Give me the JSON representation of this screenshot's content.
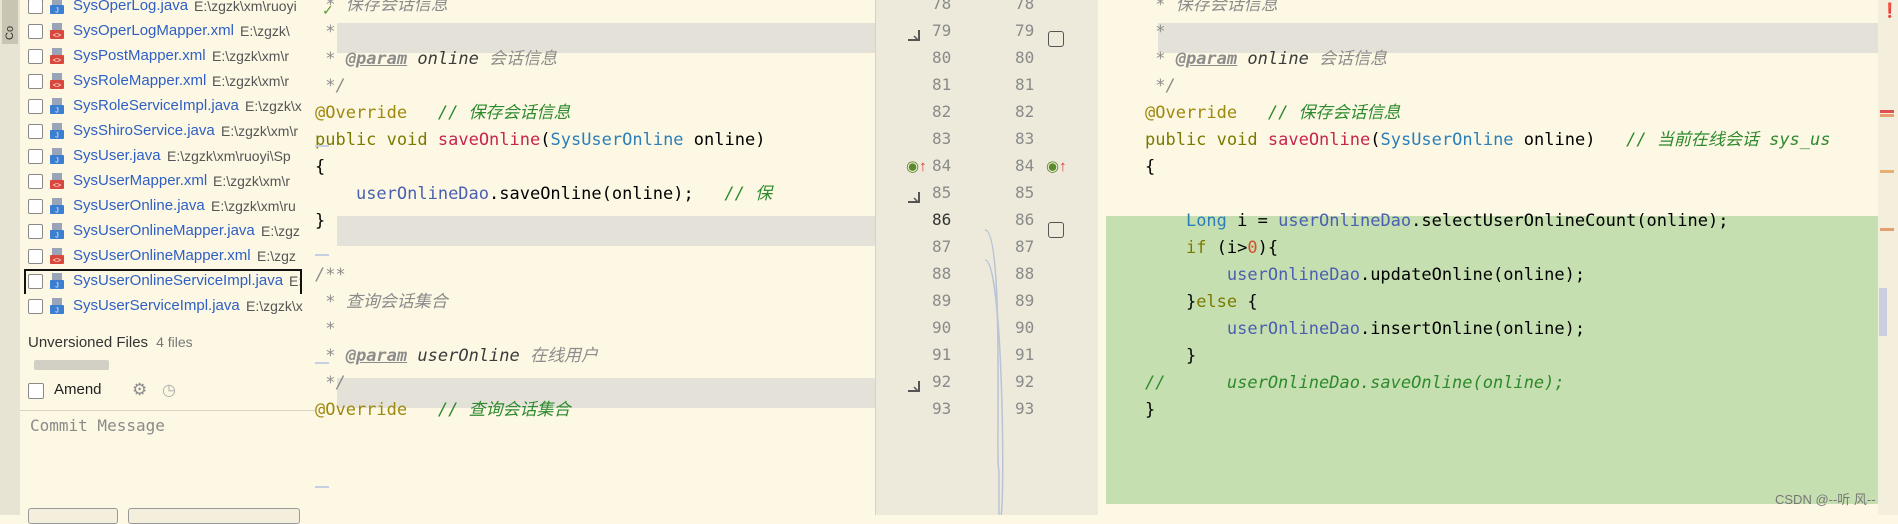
{
  "toolstrip": {
    "label": "Co"
  },
  "commit_panel": {
    "files": [
      {
        "name": "SysOperLog.java",
        "path": "E:\\zgzk\\xm\\ruoyi",
        "icon": "java-class-icon"
      },
      {
        "name": "SysOperLogMapper.xml",
        "path": "E:\\zgzk\\",
        "icon": "xml-icon"
      },
      {
        "name": "SysPostMapper.xml",
        "path": "E:\\zgzk\\xm\\r",
        "icon": "xml-icon"
      },
      {
        "name": "SysRoleMapper.xml",
        "path": "E:\\zgzk\\xm\\r",
        "icon": "xml-icon"
      },
      {
        "name": "SysRoleServiceImpl.java",
        "path": "E:\\zgzk\\x",
        "icon": "java-class-icon"
      },
      {
        "name": "SysShiroService.java",
        "path": "E:\\zgzk\\xm\\r",
        "icon": "java-class-icon"
      },
      {
        "name": "SysUser.java",
        "path": "E:\\zgzk\\xm\\ruoyi\\Sp",
        "icon": "java-class-icon"
      },
      {
        "name": "SysUserMapper.xml",
        "path": "E:\\zgzk\\xm\\r",
        "icon": "xml-icon"
      },
      {
        "name": "SysUserOnline.java",
        "path": "E:\\zgzk\\xm\\ru",
        "icon": "java-class-icon"
      },
      {
        "name": "SysUserOnlineMapper.java",
        "path": "E:\\zgz",
        "icon": "java-class-icon"
      },
      {
        "name": "SysUserOnlineMapper.xml",
        "path": "E:\\zgz",
        "icon": "xml-icon"
      },
      {
        "name": "SysUserOnlineServiceImpl.java",
        "path": "E:",
        "icon": "java-class-icon",
        "selected": true
      },
      {
        "name": "SysUserServiceImpl.java",
        "path": "E:\\zgzk\\x",
        "icon": "java-class-icon"
      }
    ],
    "unversioned_label": "Unversioned Files",
    "unversioned_count": "4 files",
    "amend_label": "Amend",
    "commit_placeholder": "Commit Message"
  },
  "diff": {
    "left_lines": [
      {
        "num": "78",
        "text": " * 保存会话信息"
      },
      {
        "num": "79",
        "text": " *"
      },
      {
        "num": "80",
        "text": " * @param online 会话信息"
      },
      {
        "num": "81",
        "text": " */"
      },
      {
        "num": "82",
        "text": "@Override   // 保存会话信息"
      },
      {
        "num": "83",
        "text": "public void saveOnline(SysUserOnline online)"
      },
      {
        "num": "84",
        "text": "{"
      },
      {
        "num": "85",
        "text": "    userOnlineDao.saveOnline(online);   // 保"
      },
      {
        "num": "86",
        "text": "}"
      },
      {
        "num": "87",
        "text": ""
      },
      {
        "num": "88",
        "text": "/**"
      },
      {
        "num": "89",
        "text": " * 查询会话集合"
      },
      {
        "num": "90",
        "text": " *"
      },
      {
        "num": "91",
        "text": " * @param userOnline 在线用户"
      },
      {
        "num": "92",
        "text": " */"
      },
      {
        "num": "93",
        "text": "@Override   // 查询会话集合"
      }
    ],
    "right_lines": [
      {
        "num": "78",
        "text": " * 保存会话信息"
      },
      {
        "num": "79",
        "text": " *"
      },
      {
        "num": "80",
        "text": " * @param online 会话信息"
      },
      {
        "num": "81",
        "text": " */"
      },
      {
        "num": "82",
        "text": "@Override   // 保存会话信息"
      },
      {
        "num": "83",
        "text": "public void saveOnline(SysUserOnline online)   // 当前在线会话 sys_us"
      },
      {
        "num": "84",
        "text": "{"
      },
      {
        "num": "85",
        "text": ""
      },
      {
        "num": "86",
        "text": "    Long i = userOnlineDao.selectUserOnlineCount(online);"
      },
      {
        "num": "87",
        "text": "    if (i>0){"
      },
      {
        "num": "88",
        "text": "        userOnlineDao.updateOnline(online);"
      },
      {
        "num": "89",
        "text": "    }else {"
      },
      {
        "num": "90",
        "text": "        userOnlineDao.insertOnline(online);"
      },
      {
        "num": "91",
        "text": "    }"
      },
      {
        "num": "92",
        "text": "//      userOnlineDao.saveOnline(online);"
      },
      {
        "num": "93",
        "text": "}"
      }
    ]
  },
  "watermark": "CSDN @--听 风--",
  "colors": {
    "added_bg": "#c6dfb0",
    "changed_bg": "#e4e2d8",
    "link": "#2f5fc4",
    "bg": "#fdf8e4"
  }
}
